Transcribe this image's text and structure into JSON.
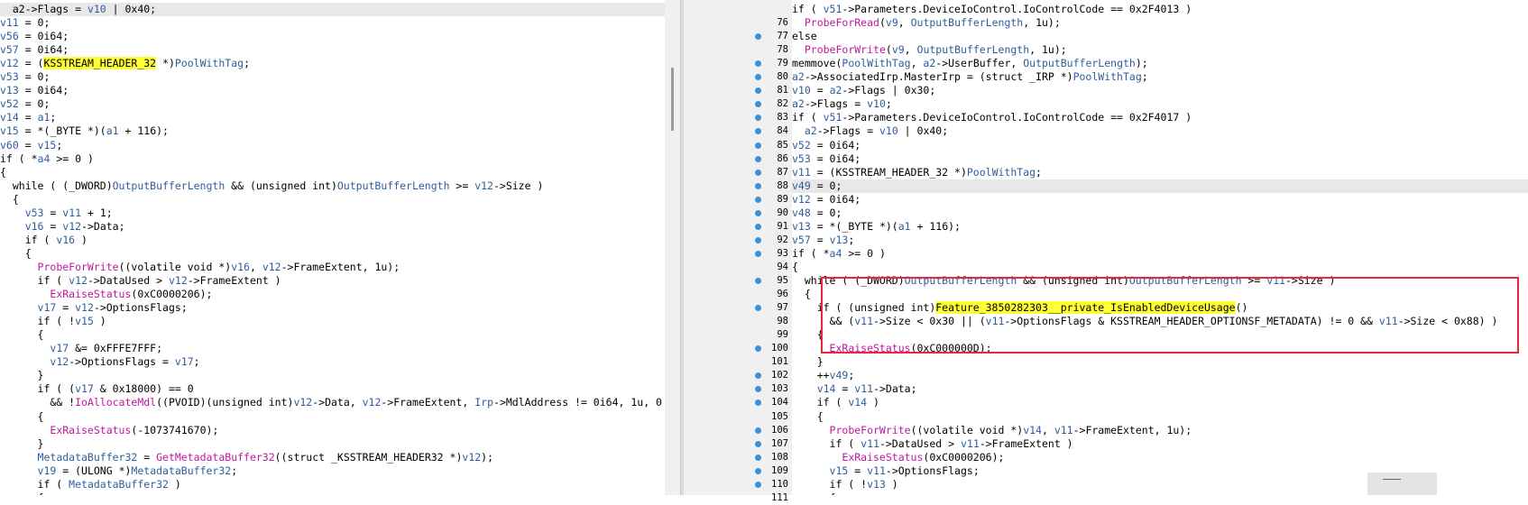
{
  "left_pane": {
    "lines": [
      [
        {
          "t": "  a2->Flags = "
        },
        {
          "t": "v10",
          "c": "v"
        },
        {
          "t": " | 0x40;"
        }
      ],
      [
        {
          "t": "v11",
          "c": "v"
        },
        {
          "t": " = 0;"
        }
      ],
      [
        {
          "t": "v56",
          "c": "v"
        },
        {
          "t": " = 0i64;"
        }
      ],
      [
        {
          "t": "v57",
          "c": "v"
        },
        {
          "t": " = 0i64;"
        }
      ],
      [
        {
          "t": "v12",
          "c": "v"
        },
        {
          "t": " = ("
        },
        {
          "t": "KSSTREAM_HEADER_32",
          "c": "y"
        },
        {
          "t": " *)"
        },
        {
          "t": "PoolWithTag",
          "c": "v"
        },
        {
          "t": ";"
        }
      ],
      [
        {
          "t": "v53",
          "c": "v"
        },
        {
          "t": " = 0;"
        }
      ],
      [
        {
          "t": "v13",
          "c": "v"
        },
        {
          "t": " = 0i64;"
        }
      ],
      [
        {
          "t": "v52",
          "c": "v"
        },
        {
          "t": " = 0;"
        }
      ],
      [
        {
          "t": "v14",
          "c": "v"
        },
        {
          "t": " = "
        },
        {
          "t": "a1",
          "c": "v"
        },
        {
          "t": ";"
        }
      ],
      [
        {
          "t": "v15",
          "c": "v"
        },
        {
          "t": " = *(_BYTE *)("
        },
        {
          "t": "a1",
          "c": "v"
        },
        {
          "t": " + 116);"
        }
      ],
      [
        {
          "t": "v60",
          "c": "v"
        },
        {
          "t": " = "
        },
        {
          "t": "v15",
          "c": "v"
        },
        {
          "t": ";"
        }
      ],
      [
        {
          "t": "if ( *"
        },
        {
          "t": "a4",
          "c": "v"
        },
        {
          "t": " >= 0 )"
        }
      ],
      [
        {
          "t": "{"
        }
      ],
      [
        {
          "t": "  while ( (_DWORD)"
        },
        {
          "t": "OutputBufferLength",
          "c": "v"
        },
        {
          "t": " && (unsigned int)"
        },
        {
          "t": "OutputBufferLength",
          "c": "v"
        },
        {
          "t": " >= "
        },
        {
          "t": "v12",
          "c": "v"
        },
        {
          "t": "->Size )"
        }
      ],
      [
        {
          "t": "  {"
        }
      ],
      [
        {
          "t": "    "
        },
        {
          "t": "v53",
          "c": "v"
        },
        {
          "t": " = "
        },
        {
          "t": "v11",
          "c": "v"
        },
        {
          "t": " + 1;"
        }
      ],
      [
        {
          "t": "    "
        },
        {
          "t": "v16",
          "c": "v"
        },
        {
          "t": " = "
        },
        {
          "t": "v12",
          "c": "v"
        },
        {
          "t": "->Data;"
        }
      ],
      [
        {
          "t": "    if ( "
        },
        {
          "t": "v16",
          "c": "v"
        },
        {
          "t": " )"
        }
      ],
      [
        {
          "t": "    {"
        }
      ],
      [
        {
          "t": "      "
        },
        {
          "t": "ProbeForWrite",
          "c": "f"
        },
        {
          "t": "((volatile void *)"
        },
        {
          "t": "v16",
          "c": "v"
        },
        {
          "t": ", "
        },
        {
          "t": "v12",
          "c": "v"
        },
        {
          "t": "->FrameExtent, 1u);"
        }
      ],
      [
        {
          "t": "      if ( "
        },
        {
          "t": "v12",
          "c": "v"
        },
        {
          "t": "->DataUsed > "
        },
        {
          "t": "v12",
          "c": "v"
        },
        {
          "t": "->FrameExtent )"
        }
      ],
      [
        {
          "t": "        "
        },
        {
          "t": "ExRaiseStatus",
          "c": "f"
        },
        {
          "t": "(0xC0000206);"
        }
      ],
      [
        {
          "t": "      "
        },
        {
          "t": "v17",
          "c": "v"
        },
        {
          "t": " = "
        },
        {
          "t": "v12",
          "c": "v"
        },
        {
          "t": "->OptionsFlags;"
        }
      ],
      [
        {
          "t": "      if ( !"
        },
        {
          "t": "v15",
          "c": "v"
        },
        {
          "t": " )"
        }
      ],
      [
        {
          "t": "      {"
        }
      ],
      [
        {
          "t": "        "
        },
        {
          "t": "v17",
          "c": "v"
        },
        {
          "t": " &= 0xFFFE7FFF;"
        }
      ],
      [
        {
          "t": "        "
        },
        {
          "t": "v12",
          "c": "v"
        },
        {
          "t": "->OptionsFlags = "
        },
        {
          "t": "v17",
          "c": "v"
        },
        {
          "t": ";"
        }
      ],
      [
        {
          "t": "      }"
        }
      ],
      [
        {
          "t": "      if ( ("
        },
        {
          "t": "v17",
          "c": "v"
        },
        {
          "t": " & 0x18000) == 0"
        }
      ],
      [
        {
          "t": "        && !"
        },
        {
          "t": "IoAllocateMdl",
          "c": "f"
        },
        {
          "t": "((PVOID)(unsigned int)"
        },
        {
          "t": "v12",
          "c": "v"
        },
        {
          "t": "->Data, "
        },
        {
          "t": "v12",
          "c": "v"
        },
        {
          "t": "->FrameExtent, "
        },
        {
          "t": "Irp",
          "c": "v"
        },
        {
          "t": "->MdlAddress != 0i64, 1u, 0"
        }
      ],
      [
        {
          "t": "      {"
        }
      ],
      [
        {
          "t": "        "
        },
        {
          "t": "ExRaiseStatus",
          "c": "f"
        },
        {
          "t": "(-1073741670);"
        }
      ],
      [
        {
          "t": "      }"
        }
      ],
      [
        {
          "t": "      "
        },
        {
          "t": "MetadataBuffer32",
          "c": "v"
        },
        {
          "t": " = "
        },
        {
          "t": "GetMetadataBuffer32",
          "c": "f"
        },
        {
          "t": "((struct _KSSTREAM_HEADER32 *)"
        },
        {
          "t": "v12",
          "c": "v"
        },
        {
          "t": ");"
        }
      ],
      [
        {
          "t": "      "
        },
        {
          "t": "v19",
          "c": "v"
        },
        {
          "t": " = (ULONG *)"
        },
        {
          "t": "MetadataBuffer32",
          "c": "v"
        },
        {
          "t": ";"
        }
      ],
      [
        {
          "t": "      if ( "
        },
        {
          "t": "MetadataBuffer32",
          "c": "v"
        },
        {
          "t": " )"
        }
      ],
      [
        {
          "t": "      {"
        }
      ]
    ]
  },
  "right_pane": {
    "line_numbers": [
      "",
      "76",
      "77",
      "78",
      "79",
      "80",
      "81",
      "82",
      "83",
      "84",
      "85",
      "86",
      "87",
      "88",
      "89",
      "90",
      "91",
      "92",
      "93",
      "94",
      "95",
      "96",
      "97",
      "98",
      "99",
      "100",
      "101",
      "102",
      "103",
      "104",
      "105",
      "106",
      "107",
      "108",
      "109",
      "110",
      "111"
    ],
    "breakpoints": [
      false,
      false,
      true,
      false,
      true,
      true,
      true,
      true,
      true,
      true,
      true,
      true,
      true,
      true,
      true,
      true,
      true,
      true,
      true,
      false,
      true,
      false,
      true,
      false,
      false,
      true,
      false,
      true,
      true,
      true,
      false,
      true,
      true,
      true,
      true,
      true,
      false
    ],
    "lines": [
      [
        {
          "t": "if ( "
        },
        {
          "t": "v51",
          "c": "v"
        },
        {
          "t": "->Parameters.DeviceIoControl.IoControlCode == 0x2F4013 )"
        }
      ],
      [
        {
          "t": "  "
        },
        {
          "t": "ProbeForRead",
          "c": "f"
        },
        {
          "t": "("
        },
        {
          "t": "v9",
          "c": "v"
        },
        {
          "t": ", "
        },
        {
          "t": "OutputBufferLength",
          "c": "v"
        },
        {
          "t": ", 1u);"
        }
      ],
      [
        {
          "t": "else"
        }
      ],
      [
        {
          "t": "  "
        },
        {
          "t": "ProbeForWrite",
          "c": "f"
        },
        {
          "t": "("
        },
        {
          "t": "v9",
          "c": "v"
        },
        {
          "t": ", "
        },
        {
          "t": "OutputBufferLength",
          "c": "v"
        },
        {
          "t": ", 1u);"
        }
      ],
      [
        {
          "t": "memmove("
        },
        {
          "t": "PoolWithTag",
          "c": "v"
        },
        {
          "t": ", "
        },
        {
          "t": "a2",
          "c": "v"
        },
        {
          "t": "->UserBuffer, "
        },
        {
          "t": "OutputBufferLength",
          "c": "v"
        },
        {
          "t": ");"
        }
      ],
      [
        {
          "t": "a2",
          "c": "v"
        },
        {
          "t": "->AssociatedIrp.MasterIrp = (struct _IRP *)"
        },
        {
          "t": "PoolWithTag",
          "c": "v"
        },
        {
          "t": ";"
        }
      ],
      [
        {
          "t": "v10",
          "c": "v"
        },
        {
          "t": " = "
        },
        {
          "t": "a2",
          "c": "v"
        },
        {
          "t": "->Flags | 0x30;"
        }
      ],
      [
        {
          "t": "a2",
          "c": "v"
        },
        {
          "t": "->Flags = "
        },
        {
          "t": "v10",
          "c": "v"
        },
        {
          "t": ";"
        }
      ],
      [
        {
          "t": "if ( "
        },
        {
          "t": "v51",
          "c": "v"
        },
        {
          "t": "->Parameters.DeviceIoControl.IoControlCode == 0x2F4017 )"
        }
      ],
      [
        {
          "t": "  "
        },
        {
          "t": "a2",
          "c": "v"
        },
        {
          "t": "->Flags = "
        },
        {
          "t": "v10",
          "c": "v"
        },
        {
          "t": " | 0x40;"
        }
      ],
      [
        {
          "t": "v52",
          "c": "v"
        },
        {
          "t": " = 0i64;"
        }
      ],
      [
        {
          "t": "v53",
          "c": "v"
        },
        {
          "t": " = 0i64;"
        }
      ],
      [
        {
          "t": "v11",
          "c": "v"
        },
        {
          "t": " = (KSSTREAM_HEADER_32 *)"
        },
        {
          "t": "PoolWithTag",
          "c": "v"
        },
        {
          "t": ";"
        }
      ],
      [
        {
          "t": "v49",
          "c": "v"
        },
        {
          "t": " = 0;"
        }
      ],
      [
        {
          "t": "v12",
          "c": "v"
        },
        {
          "t": " = 0i64;"
        }
      ],
      [
        {
          "t": "v48",
          "c": "v"
        },
        {
          "t": " = 0;"
        }
      ],
      [
        {
          "t": "v13",
          "c": "v"
        },
        {
          "t": " = *(_BYTE *)("
        },
        {
          "t": "a1",
          "c": "v"
        },
        {
          "t": " + 116);"
        }
      ],
      [
        {
          "t": "v57",
          "c": "v"
        },
        {
          "t": " = "
        },
        {
          "t": "v13",
          "c": "v"
        },
        {
          "t": ";"
        }
      ],
      [
        {
          "t": "if ( *"
        },
        {
          "t": "a4",
          "c": "v"
        },
        {
          "t": " >= 0 )"
        }
      ],
      [
        {
          "t": "{"
        }
      ],
      [
        {
          "t": "  while ( (_DWORD)"
        },
        {
          "t": "OutputBufferLength",
          "c": "v"
        },
        {
          "t": " && (unsigned int)"
        },
        {
          "t": "OutputBufferLength",
          "c": "v"
        },
        {
          "t": " >= "
        },
        {
          "t": "v11",
          "c": "v"
        },
        {
          "t": "->Size )"
        }
      ],
      [
        {
          "t": "  {"
        }
      ],
      [
        {
          "t": "    if ( (unsigned int)"
        },
        {
          "t": "Feature_3850282303__private_IsEnabledDeviceUsage",
          "c": "y"
        },
        {
          "t": "()"
        }
      ],
      [
        {
          "t": "      && ("
        },
        {
          "t": "v11",
          "c": "v"
        },
        {
          "t": "->Size < 0x30 || ("
        },
        {
          "t": "v11",
          "c": "v"
        },
        {
          "t": "->OptionsFlags & KSSTREAM_HEADER_OPTIONSF_METADATA) != 0 && "
        },
        {
          "t": "v11",
          "c": "v"
        },
        {
          "t": "->Size < 0x88) )"
        }
      ],
      [
        {
          "t": "    {"
        }
      ],
      [
        {
          "t": "      "
        },
        {
          "t": "ExRaiseStatus",
          "c": "f"
        },
        {
          "t": "(0xC000000D);"
        }
      ],
      [
        {
          "t": "    }"
        }
      ],
      [
        {
          "t": "    ++"
        },
        {
          "t": "v49",
          "c": "v"
        },
        {
          "t": ";"
        }
      ],
      [
        {
          "t": "    "
        },
        {
          "t": "v14",
          "c": "v"
        },
        {
          "t": " = "
        },
        {
          "t": "v11",
          "c": "v"
        },
        {
          "t": "->Data;"
        }
      ],
      [
        {
          "t": "    if ( "
        },
        {
          "t": "v14",
          "c": "v"
        },
        {
          "t": " )"
        }
      ],
      [
        {
          "t": "    {"
        }
      ],
      [
        {
          "t": "      "
        },
        {
          "t": "ProbeForWrite",
          "c": "f"
        },
        {
          "t": "((volatile void *)"
        },
        {
          "t": "v14",
          "c": "v"
        },
        {
          "t": ", "
        },
        {
          "t": "v11",
          "c": "v"
        },
        {
          "t": "->FrameExtent, 1u);"
        }
      ],
      [
        {
          "t": "      if ( "
        },
        {
          "t": "v11",
          "c": "v"
        },
        {
          "t": "->DataUsed > "
        },
        {
          "t": "v11",
          "c": "v"
        },
        {
          "t": "->FrameExtent )"
        }
      ],
      [
        {
          "t": "        "
        },
        {
          "t": "ExRaiseStatus",
          "c": "f"
        },
        {
          "t": "(0xC0000206);"
        }
      ],
      [
        {
          "t": "      "
        },
        {
          "t": "v15",
          "c": "v"
        },
        {
          "t": " = "
        },
        {
          "t": "v11",
          "c": "v"
        },
        {
          "t": "->OptionsFlags;"
        }
      ],
      [
        {
          "t": "      if ( !"
        },
        {
          "t": "v13",
          "c": "v"
        },
        {
          "t": " )"
        }
      ],
      [
        {
          "t": "      {"
        }
      ]
    ]
  }
}
